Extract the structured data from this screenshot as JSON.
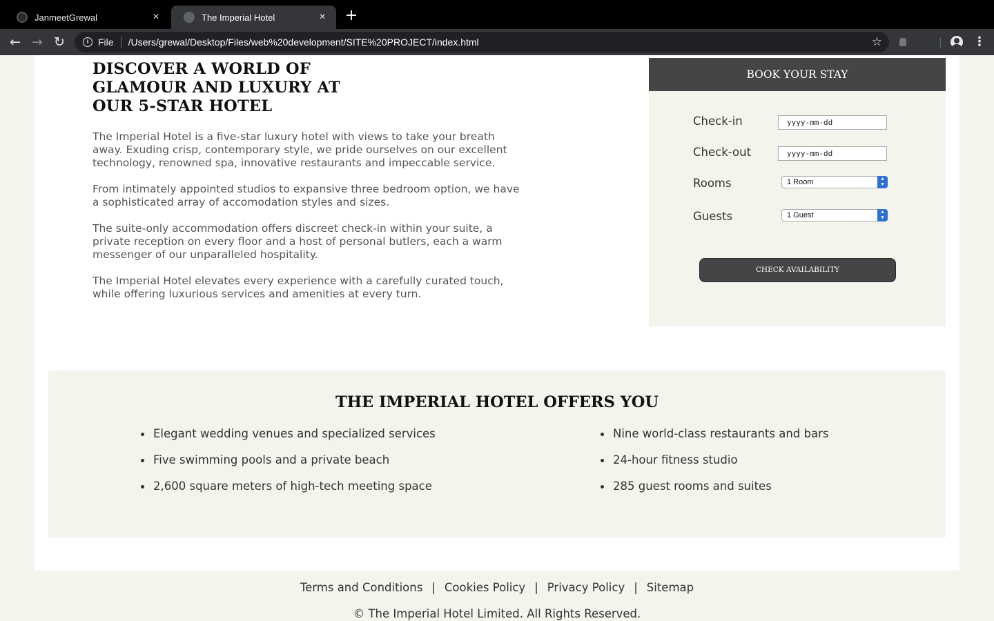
{
  "browser": {
    "tabs": [
      {
        "title": "JanmeetGrewal",
        "active": false
      },
      {
        "title": "The Imperial Hotel",
        "active": true
      }
    ],
    "new_tab_label": "+",
    "close_label": "×",
    "address_scheme": "File",
    "address_url": "/Users/grewal/Desktop/Files/web%20development/SITE%20PROJECT/index.html"
  },
  "intro": {
    "heading_lines": [
      "DISCOVER A WORLD OF",
      "GLAMOUR AND LUXURY AT",
      "OUR 5-STAR HOTEL"
    ],
    "paragraphs": [
      "The Imperial Hotel is a five-star luxury hotel with views to take your breath away. Exuding crisp, contemporary style, we pride ourselves on our excellent technology, renowned spa, innovative restaurants and impeccable service.",
      "From intimately appointed studios to expansive three bedroom option, we have a sophisticated array of accomodation styles and sizes.",
      "The suite-only accommodation offers discreet check-in within your suite, a private reception on every floor and a host of personal butlers, each a warm messenger of our unparalleled hospitality.",
      "The Imperial Hotel elevates every experience with a carefully curated touch, while offering luxurious services and amenities at every turn."
    ]
  },
  "booking": {
    "header": "BOOK YOUR STAY",
    "checkin_label": "Check-in",
    "checkin_placeholder": "yyyy-mm-dd",
    "checkout_label": "Check-out",
    "checkout_placeholder": "yyyy-mm-dd",
    "rooms_label": "Rooms",
    "rooms_value": "1 Room",
    "guests_label": "Guests",
    "guests_value": "1 Guest",
    "button": "CHECK AVAILABILITY"
  },
  "offers": {
    "title": "THE IMPERIAL HOTEL OFFERS YOU",
    "left": [
      "Elegant wedding venues and specialized services",
      "Five swimming pools and a private beach",
      "2,600 square meters of high-tech meeting space"
    ],
    "right": [
      "Nine world-class restaurants and bars",
      "24-hour fitness studio",
      "285 guest rooms and suites"
    ]
  },
  "footer": {
    "links": [
      "Terms and Conditions",
      "Cookies Policy",
      "Privacy Policy",
      "Sitemap"
    ],
    "separator": "|",
    "copyright": "© The Imperial Hotel Limited. All Rights Reserved."
  },
  "colors": {
    "page_bg": "#f4f3ec",
    "dark_accent": "#454545",
    "select_arrow": "#2d6fd6"
  }
}
